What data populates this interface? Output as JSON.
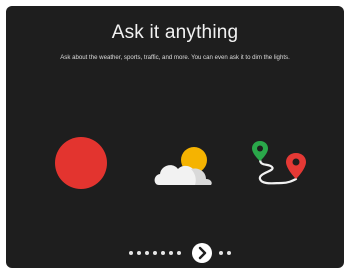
{
  "page": {
    "title": "Ask it anything",
    "subtitle": "Ask about the weather, sports, traffic, and more. You can even ask it to dim the lights."
  },
  "illustrations": [
    {
      "name": "mic-circle-icon",
      "color": "#e3342f"
    },
    {
      "name": "weather-icon",
      "sun_color": "#f5b301",
      "cloud_color": "#f2f2f2"
    },
    {
      "name": "route-icon",
      "start_pin_color": "#2aa84a",
      "end_pin_color": "#e53935"
    }
  ],
  "pager": {
    "dots_before": 7,
    "dots_after": 2,
    "next_icon": "chevron-right-icon"
  },
  "colors": {
    "background": "#1e1e1e",
    "text": "#f2f2f2"
  }
}
